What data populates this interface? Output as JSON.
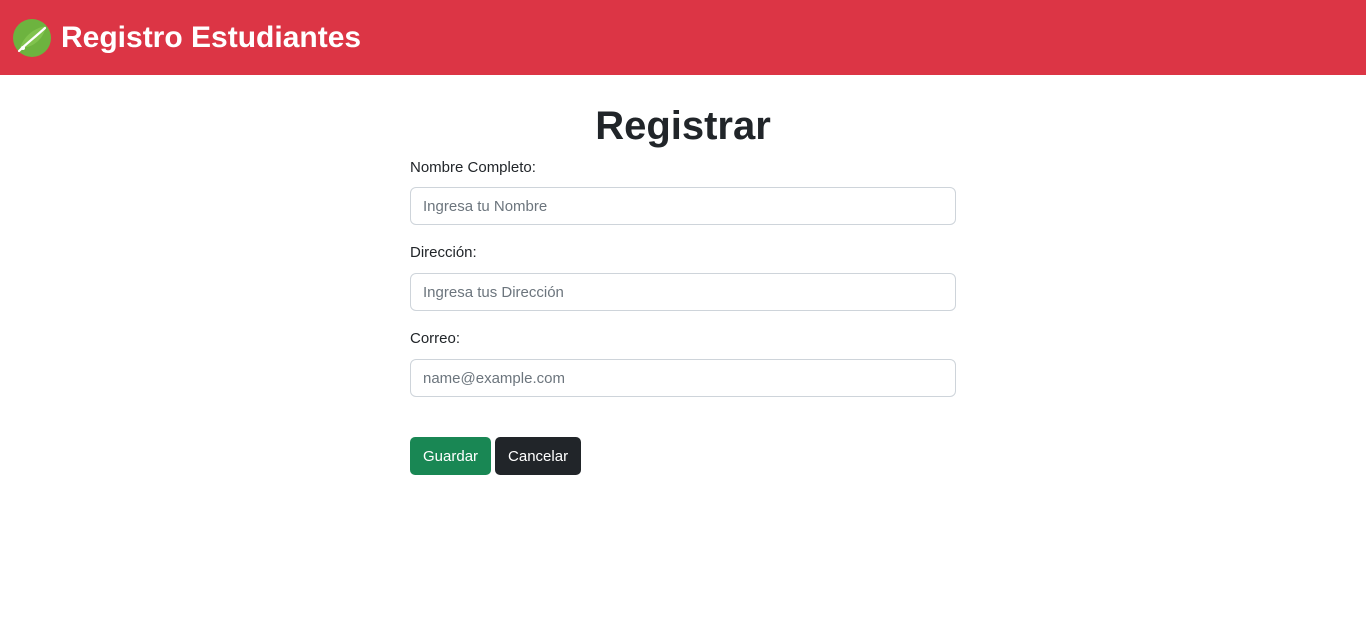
{
  "navbar": {
    "brand_title": "Registro Estudiantes",
    "logo_icon": "leaf-logo-icon",
    "background_color": "#dc3545",
    "logo_color": "#6db33f"
  },
  "form": {
    "heading": "Registrar",
    "fields": [
      {
        "label": "Nombre Completo:",
        "value": "",
        "placeholder": "Ingresa tu Nombre"
      },
      {
        "label": "Dirección:",
        "value": "",
        "placeholder": "Ingresa tus Dirección"
      },
      {
        "label": "Correo:",
        "value": "",
        "placeholder": "name@example.com"
      }
    ],
    "save_label": "Guardar",
    "cancel_label": "Cancelar",
    "save_color": "#198754",
    "cancel_color": "#212529"
  }
}
